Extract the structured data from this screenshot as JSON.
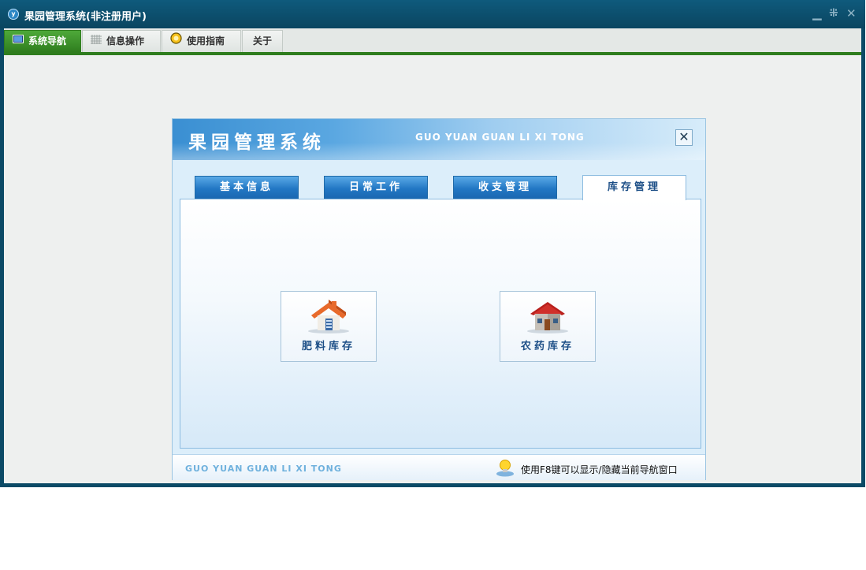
{
  "window": {
    "title": "果园管理系统(非注册用户)",
    "icon": "app-logo-icon",
    "controls": {
      "minimize": "minimize-icon",
      "restore": "restore-icon",
      "close": "close-icon"
    }
  },
  "menu": {
    "items": [
      {
        "label": "系统导航",
        "icon": "monitor-icon",
        "active": true
      },
      {
        "label": "信息操作",
        "icon": "grid-icon",
        "active": false
      },
      {
        "label": "使用指南",
        "icon": "compass-icon",
        "active": false
      },
      {
        "label": "关于",
        "active": false
      }
    ]
  },
  "panel": {
    "title": "果园管理系统",
    "subtitle": "GUO YUAN GUAN LI XI TONG",
    "close_icon": "close-icon",
    "tabs": [
      {
        "label": "基本信息",
        "active": false
      },
      {
        "label": "日常工作",
        "active": false
      },
      {
        "label": "收支管理",
        "active": false
      },
      {
        "label": "库存管理",
        "active": true
      }
    ],
    "modules": [
      {
        "label": "肥料库存",
        "icon": "fertilizer-house-icon"
      },
      {
        "label": "农药库存",
        "icon": "pesticide-house-icon"
      }
    ],
    "footer": {
      "left_text": "GUO YUAN GUAN LI XI TONG",
      "hint": "使用F8键可以显示/隐藏当前导航窗口",
      "hint_icon": "lightbulb-icon"
    }
  },
  "colors": {
    "titlebar": "#0b4a66",
    "menu_active": "#2f7d1e",
    "tab_blue": "#2277c4",
    "panel_text": "#1d4f87"
  }
}
